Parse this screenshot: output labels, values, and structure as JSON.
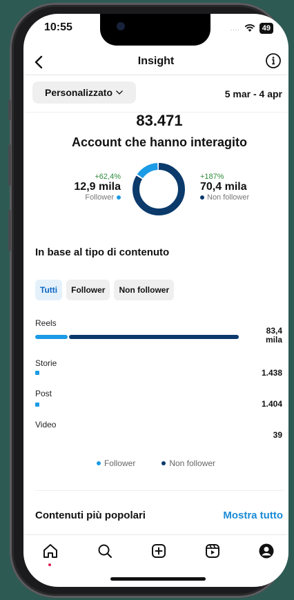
{
  "status_bar": {
    "time": "10:55",
    "signal": "....",
    "battery": "49"
  },
  "header": {
    "title": "Insight"
  },
  "filter": {
    "label": "Personalizzato",
    "date_range": "5 mar - 4 apr"
  },
  "summary": {
    "total": "83.471",
    "label": "Account che hanno interagito",
    "followers": {
      "pct": "+62,4%",
      "value": "12,9 mila",
      "label": "Follower",
      "share": 0.155
    },
    "non_followers": {
      "pct": "+187%",
      "value": "70,4 mila",
      "label": "Non follower",
      "share": 0.845
    }
  },
  "content": {
    "title": "In base al tipo di contenuto",
    "tabs": [
      "Tutti",
      "Follower",
      "Non follower"
    ],
    "rows": [
      {
        "label": "Reels",
        "value": "83,4",
        "value2": "mila",
        "follower_frac": 0.16,
        "nonfollower_frac": 0.84,
        "total_frac": 1.0
      },
      {
        "label": "Storie",
        "value": "1.438",
        "value2": "",
        "follower_frac": 1.0,
        "nonfollower_frac": 0.0,
        "total_frac": 0.02
      },
      {
        "label": "Post",
        "value": "1.404",
        "value2": "",
        "follower_frac": 1.0,
        "nonfollower_frac": 0.0,
        "total_frac": 0.02
      },
      {
        "label": "Video",
        "value": "39",
        "value2": "",
        "follower_frac": 0.0,
        "nonfollower_frac": 0.0,
        "total_frac": 0.0
      }
    ],
    "legend": {
      "follower": "Follower",
      "non_follower": "Non follower"
    }
  },
  "popular": {
    "title": "Contenuti più popolari",
    "link": "Mostra tutto"
  },
  "colors": {
    "follower": "#1c9be6",
    "non_follower": "#0b3a6b",
    "positive": "#2e8b3a",
    "link": "#1a8ad6"
  },
  "tabbar": [
    "home-icon",
    "search-icon",
    "create-icon",
    "reels-icon",
    "profile-icon"
  ]
}
